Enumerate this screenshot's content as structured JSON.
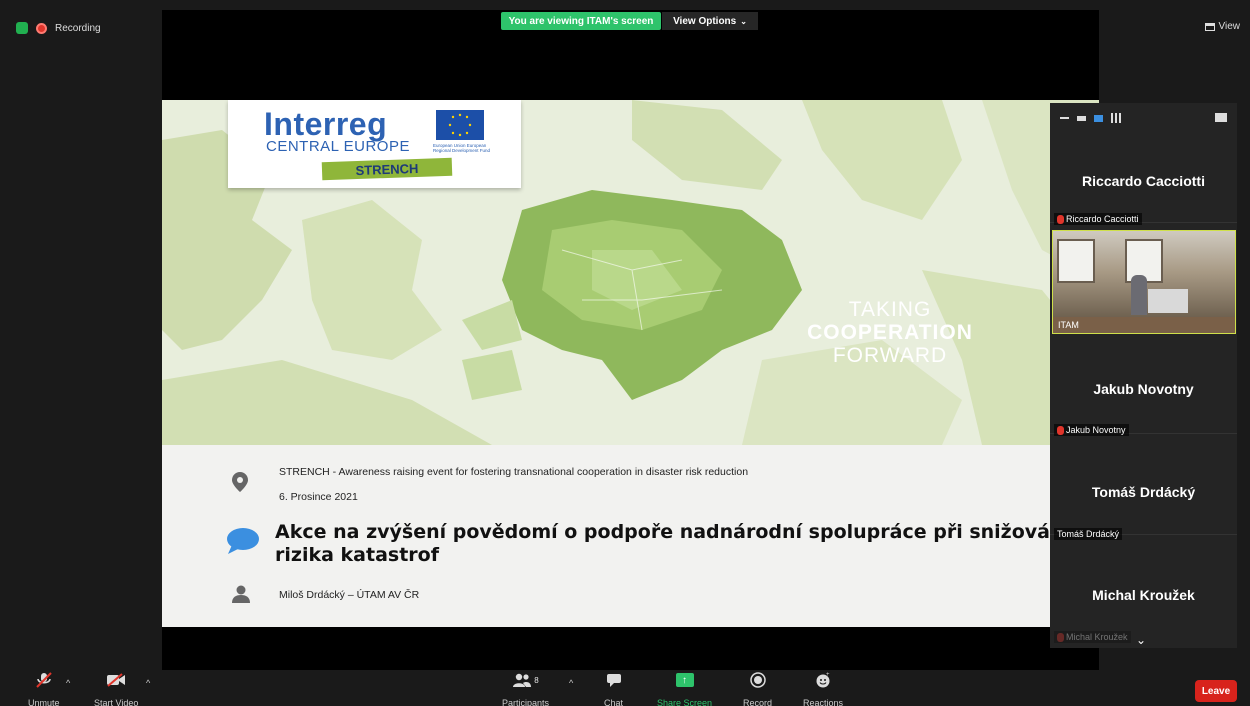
{
  "top": {
    "recording_label": "Recording",
    "viewing_banner": "You are viewing ITAM's screen",
    "view_options": "View Options",
    "view_button": "View"
  },
  "slide": {
    "logo": {
      "interreg": "Interreg",
      "central_europe": "CENTRAL EUROPE",
      "project": "STRENCH",
      "eu_text": "European Union European Regional Development Fund"
    },
    "tagline": [
      "TAKING",
      "COOPERATION",
      "FORWARD"
    ],
    "event_line": "STRENCH -  Awareness raising event for fostering transnational cooperation in disaster risk reduction",
    "date_line": "6. Prosince  2021",
    "title": "Akce na zvýšení povědomí o podpoře nadnárodní spolupráce při snižování rizika katastrof",
    "speaker": "Miloš Drdácký  – ÚTAM AV ČR"
  },
  "panel": {
    "participants": [
      {
        "name": "Riccardo Cacciotti",
        "label": "Riccardo Cacciotti",
        "muted": true
      },
      {
        "name": "ITAM",
        "label": "ITAM",
        "video": true
      },
      {
        "name": "Jakub Novotny",
        "label": "Jakub Novotny",
        "muted": true
      },
      {
        "name": "Tomáš Drdácký",
        "label": "Tomáš Drdácký",
        "muted": false
      },
      {
        "name": "Michal Kroužek",
        "label": "Michal Kroužek",
        "muted": true
      }
    ]
  },
  "bottom": {
    "unmute": "Unmute",
    "start_video": "Start Video",
    "participants_count": "8",
    "participants": "Participants",
    "chat": "Chat",
    "share_screen": "Share Screen",
    "record": "Record",
    "reactions": "Reactions",
    "leave": "Leave"
  },
  "colors": {
    "accent_green": "#2ec36b",
    "leave_red": "#d8231c",
    "interreg_blue": "#2d62b3",
    "map_green": "#9cc26a"
  }
}
